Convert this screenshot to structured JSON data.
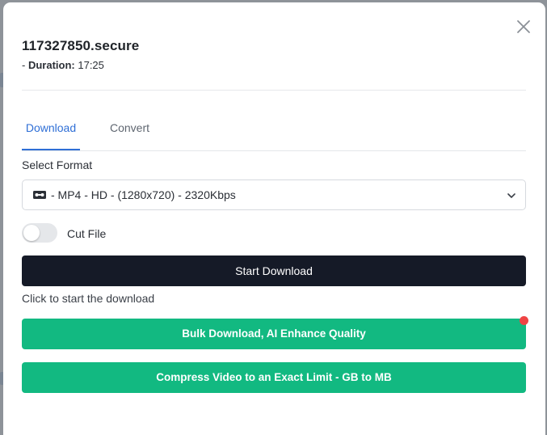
{
  "file": {
    "title": "117327850.secure",
    "meta_prefix": "- ",
    "duration_label": "Duration:",
    "duration_value": "17:25"
  },
  "tabs": [
    {
      "label": "Download",
      "active": true
    },
    {
      "label": "Convert",
      "active": false
    }
  ],
  "format": {
    "label": "Select Format",
    "selected": "- MP4 - HD - (1280x720) - 2320Kbps",
    "icon": "video-cassette-icon"
  },
  "cut_file": {
    "label": "Cut File",
    "enabled": false
  },
  "actions": {
    "start_label": "Start Download",
    "start_hint": "Click to start the download",
    "bulk_label": "Bulk Download, AI Enhance Quality",
    "compress_label": "Compress Video to an Exact Limit - GB to MB"
  },
  "colors": {
    "accent": "#2f6fd6",
    "primary_button": "#151a27",
    "green_button": "#12b981",
    "notification_dot": "#ef4444"
  }
}
